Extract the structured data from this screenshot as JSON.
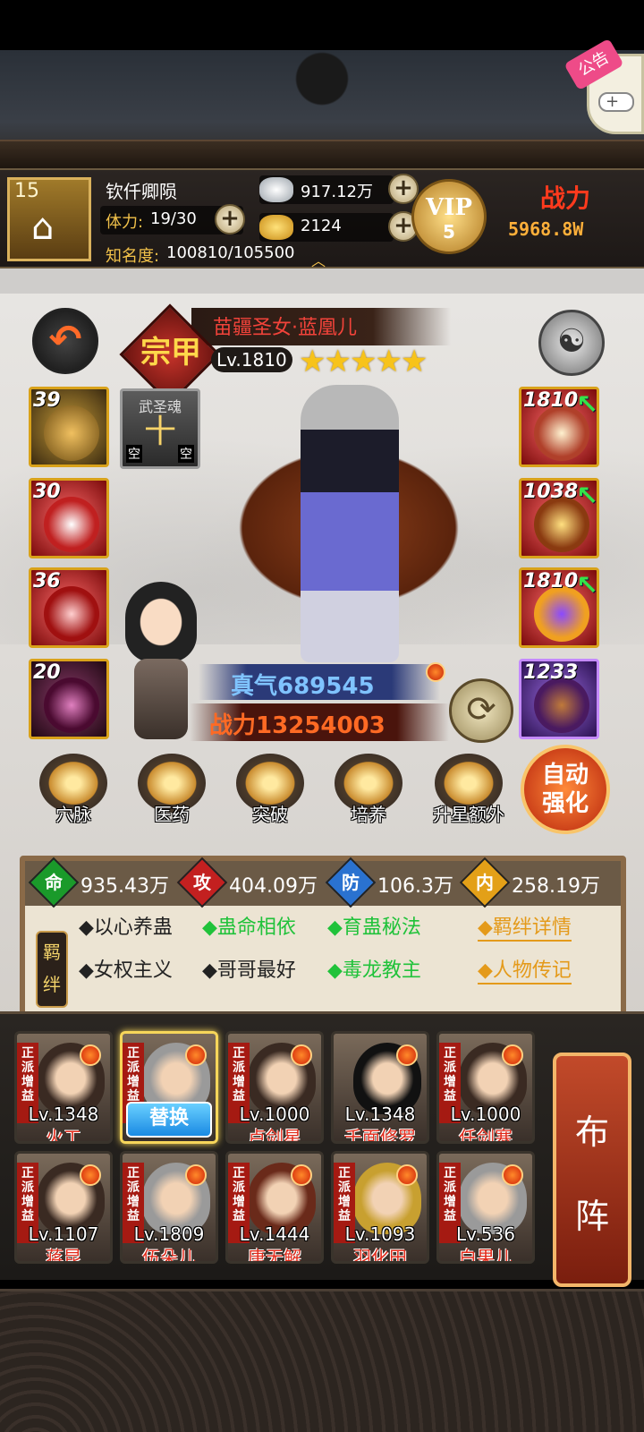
{
  "player": {
    "level": "15",
    "name": "钦仟卿陨",
    "stamina_label": "体力:",
    "stamina_value": "19/30",
    "fame_label": "知名度:",
    "fame_value": "100810/105500"
  },
  "resources": {
    "silver": "917.12万",
    "gold": "2124"
  },
  "vip": {
    "text": "VIP",
    "level": "5"
  },
  "top_combat": {
    "label": "战力",
    "value": "5968.8W"
  },
  "notice_tab": {
    "label": "公告"
  },
  "hero": {
    "title": "苗疆圣女·蓝凰儿",
    "seal": "宗甲",
    "level": "Lv.1810",
    "stars": "★★★★★",
    "star_count": 5,
    "zhenqi": "真气689545",
    "power": "战力13254003"
  },
  "left_slots": [
    {
      "num": "39"
    },
    {
      "num": "30"
    },
    {
      "num": "36"
    },
    {
      "num": "20"
    }
  ],
  "soul_slot": {
    "title": "武圣魂",
    "symbol": "十",
    "left": "空",
    "right": "空"
  },
  "right_slots": [
    {
      "num": "1810"
    },
    {
      "num": "1038"
    },
    {
      "num": "1810"
    },
    {
      "num": "1233"
    }
  ],
  "functions": [
    {
      "label": "穴脉",
      "icon": "meridian-icon"
    },
    {
      "label": "医药",
      "icon": "medicine-icon"
    },
    {
      "label": "突破",
      "icon": "breakthrough-icon"
    },
    {
      "label": "培养",
      "icon": "cultivate-icon"
    },
    {
      "label": "升星额外",
      "icon": "star-up-icon"
    }
  ],
  "auto_enhance": {
    "line1": "自动",
    "line2": "强化"
  },
  "attributes": [
    {
      "gem": "命",
      "value": "935.43万",
      "color": "#1a9a2a"
    },
    {
      "gem": "攻",
      "value": "404.09万",
      "color": "#c32020"
    },
    {
      "gem": "防",
      "value": "106.3万",
      "color": "#2a72d0"
    },
    {
      "gem": "内",
      "value": "258.19万",
      "color": "#e3a018"
    }
  ],
  "bonds": {
    "tag_1": "羁",
    "tag_2": "绊",
    "row1": [
      "◆以心养蛊",
      "◆蛊命相依",
      "◆育蛊秘法"
    ],
    "row2": [
      "◆女权主义",
      "◆哥哥最好",
      "◆毒龙教主"
    ],
    "detail_link": "◆羁绊详情",
    "bio_link": "◆人物传记"
  },
  "formation": {
    "tag": "正派增益",
    "swap_label": "替换",
    "buzhen_1": "布",
    "buzhen_2": "阵",
    "cards": [
      {
        "lv": "Lv.1348",
        "name": "火工"
      },
      {
        "lv": "",
        "name": ""
      },
      {
        "lv": "Lv.1000",
        "name": "卢剑星"
      },
      {
        "lv": "Lv.1348",
        "name": "千面修罗"
      },
      {
        "lv": "Lv.1000",
        "name": "任剑寒"
      },
      {
        "lv": "Lv.1107",
        "name": "蒋昆"
      },
      {
        "lv": "Lv.1809",
        "name": "伍朵儿"
      },
      {
        "lv": "Lv.1444",
        "name": "唐无解"
      },
      {
        "lv": "Lv.1093",
        "name": "羽化田"
      },
      {
        "lv": "Lv.536",
        "name": "白果儿"
      }
    ]
  }
}
